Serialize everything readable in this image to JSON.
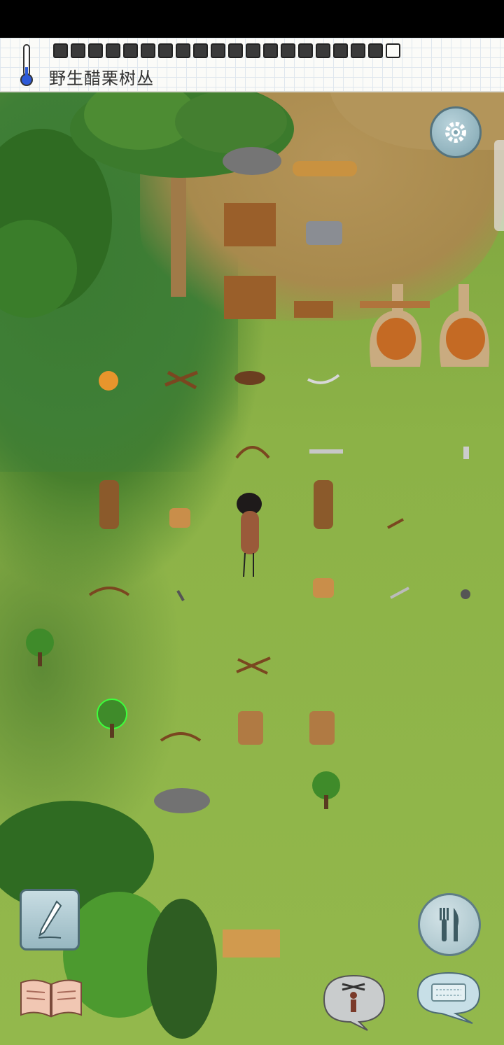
{
  "hud": {
    "object_label": "野生醋栗树丛",
    "temperature_icon": "thermometer-icon",
    "food_pips_filled": 19,
    "food_pips_total": 20
  },
  "buttons": {
    "settings_icon": "gear-icon",
    "pencil_icon": "pencil-icon",
    "book_icon": "open-book-icon",
    "eat_icon": "fork-knife-icon",
    "emote_icon": "puppet-icon",
    "keyboard_icon": "keyboard-icon"
  },
  "colors": {
    "grass": "#8cb247",
    "dark_grass": "#3f7f36",
    "dirt": "#a88a4d",
    "button_blue": "#9fbcc4"
  }
}
